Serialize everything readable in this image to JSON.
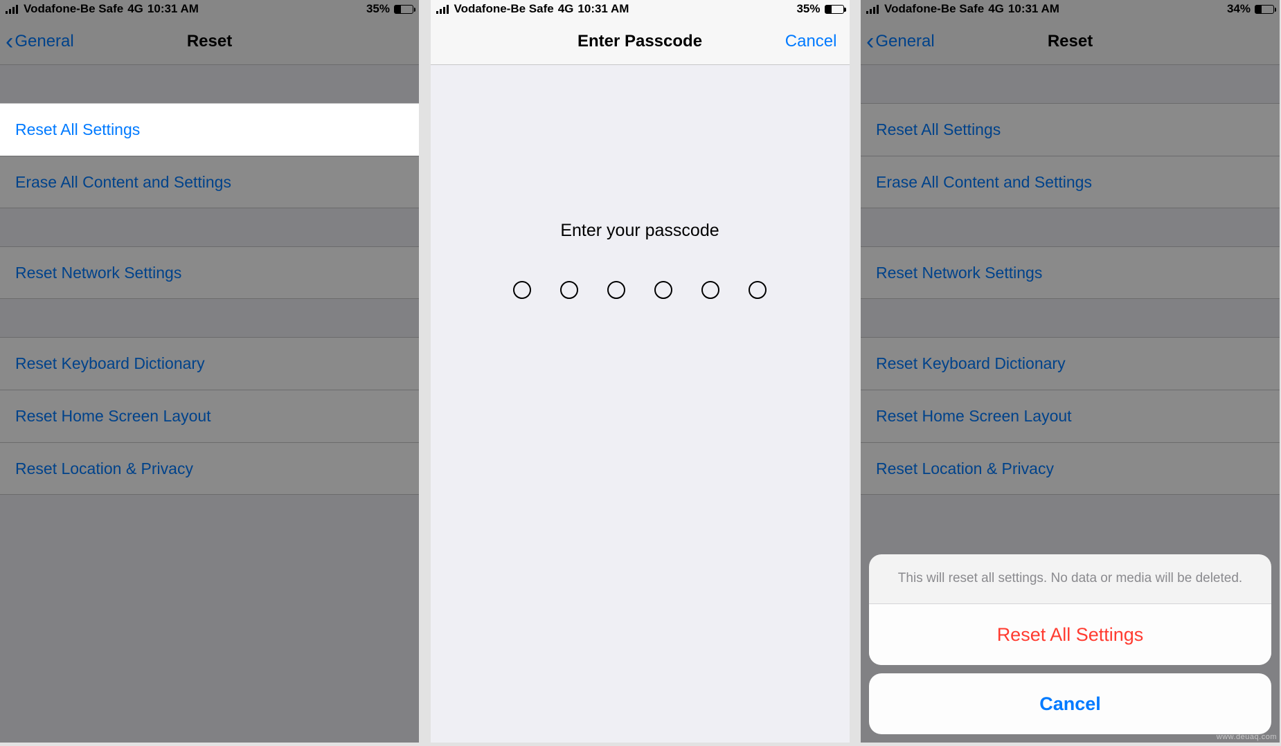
{
  "watermark": "www.deuaq.com",
  "screens": {
    "left": {
      "status": {
        "carrier": "Vodafone-Be Safe",
        "network": "4G",
        "time": "10:31 AM",
        "battery_pct": "35%",
        "battery_fill_pct": 35
      },
      "nav": {
        "back_label": "General",
        "title": "Reset"
      },
      "rows": {
        "g1r1": "Reset All Settings",
        "g1r2": "Erase All Content and Settings",
        "g2r1": "Reset Network Settings",
        "g3r1": "Reset Keyboard Dictionary",
        "g3r2": "Reset Home Screen Layout",
        "g3r3": "Reset Location & Privacy"
      }
    },
    "mid": {
      "status": {
        "carrier": "Vodafone-Be Safe",
        "network": "4G",
        "time": "10:31 AM",
        "battery_pct": "35%",
        "battery_fill_pct": 35
      },
      "nav": {
        "title": "Enter Passcode",
        "cancel": "Cancel"
      },
      "prompt": "Enter your passcode",
      "passcode_length": 6
    },
    "right": {
      "status": {
        "carrier": "Vodafone-Be Safe",
        "network": "4G",
        "time": "10:31 AM",
        "battery_pct": "34%",
        "battery_fill_pct": 34
      },
      "nav": {
        "back_label": "General",
        "title": "Reset"
      },
      "rows": {
        "g1r1": "Reset All Settings",
        "g1r2": "Erase All Content and Settings",
        "g2r1": "Reset Network Settings",
        "g3r1": "Reset Keyboard Dictionary",
        "g3r2": "Reset Home Screen Layout",
        "g3r3": "Reset Location & Privacy"
      },
      "sheet": {
        "message": "This will reset all settings. No data or media will be deleted.",
        "destructive": "Reset All Settings",
        "cancel": "Cancel"
      }
    }
  }
}
